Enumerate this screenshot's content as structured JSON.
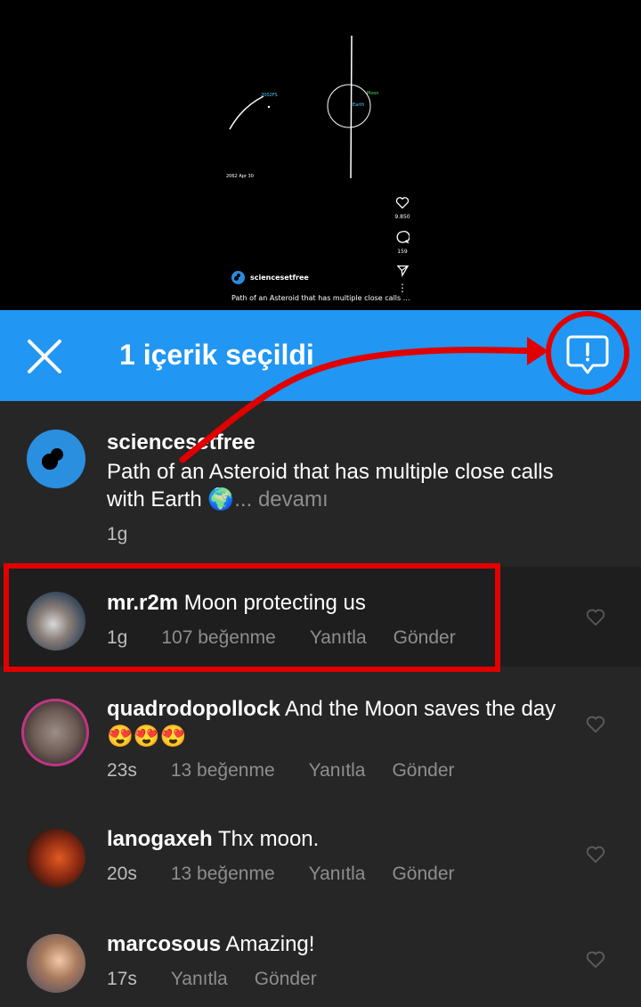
{
  "video": {
    "labels": {
      "object_label": "2002FS",
      "moon_label": "Moon",
      "earth_label": "Earth",
      "date_label": "2062 Apr 30"
    },
    "likes_count": "9.850",
    "comments_count": "159",
    "author": "sciencesetfree",
    "caption": "Path of an Asteroid that has multiple close calls ..."
  },
  "selection_bar": {
    "title": "1 içerik seçildi",
    "color": "#2196f3"
  },
  "caption_comment": {
    "username": "sciencesetfree",
    "text": "Path of an Asteroid that has multiple close calls with Earth 🌍",
    "more": "... devamı",
    "time": "1g"
  },
  "comments": [
    {
      "username": "mr.r2m",
      "text": "Moon protecting us",
      "time": "1g",
      "likes": "107 beğenme",
      "reply": "Yanıtla",
      "send": "Gönder"
    },
    {
      "username": "quadrodopollock",
      "text": "And the Moon saves the day 😍😍😍",
      "time": "23s",
      "likes": "13 beğenme",
      "reply": "Yanıtla",
      "send": "Gönder"
    },
    {
      "username": "lanogaxeh",
      "text": "Thx moon.",
      "time": "20s",
      "likes": "13 beğenme",
      "reply": "Yanıtla",
      "send": "Gönder"
    },
    {
      "username": "marcosous",
      "text": "Amazing!",
      "time": "17s",
      "reply": "Yanıtla",
      "send": "Gönder"
    }
  ],
  "colors": {
    "annotation_red": "#e00000",
    "background": "#262626",
    "selected_row": "#1e1e1e"
  }
}
